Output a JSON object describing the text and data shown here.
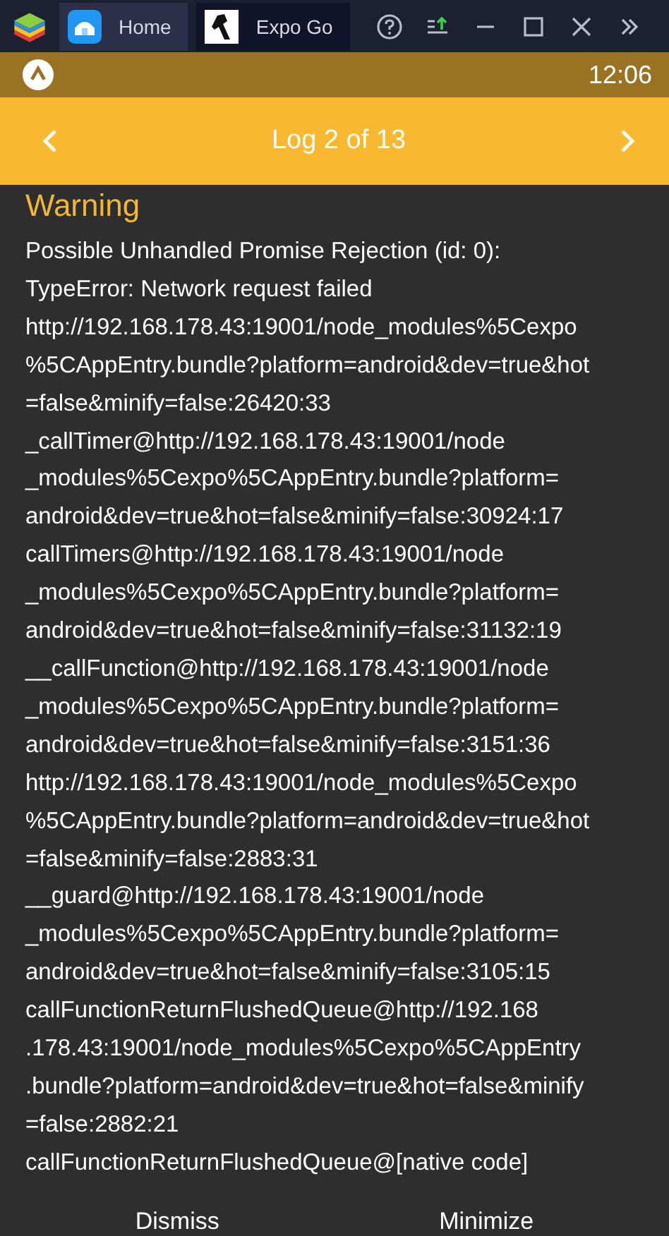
{
  "window": {
    "tabs": [
      {
        "label": "Home",
        "selected": false
      },
      {
        "label": "Expo Go",
        "selected": true
      }
    ]
  },
  "status_bar": {
    "time": "12:06"
  },
  "header": {
    "title": "Log 2 of 13"
  },
  "log": {
    "heading": "Warning",
    "lines": [
      "Possible Unhandled Promise Rejection (id: 0):",
      "TypeError: Network request failed",
      "http://192.168.178.43:19001/node_modules%5Cexpo",
      "%5CAppEntry.bundle?platform=android&dev=true&hot",
      "=false&minify=false:26420:33",
      "_callTimer@http://192.168.178.43:19001/node",
      "_modules%5Cexpo%5CAppEntry.bundle?platform=",
      "android&dev=true&hot=false&minify=false:30924:17",
      "callTimers@http://192.168.178.43:19001/node",
      "_modules%5Cexpo%5CAppEntry.bundle?platform=",
      "android&dev=true&hot=false&minify=false:31132:19",
      "__callFunction@http://192.168.178.43:19001/node",
      "_modules%5Cexpo%5CAppEntry.bundle?platform=",
      "android&dev=true&hot=false&minify=false:3151:36",
      "http://192.168.178.43:19001/node_modules%5Cexpo",
      "%5CAppEntry.bundle?platform=android&dev=true&hot",
      "=false&minify=false:2883:31",
      "__guard@http://192.168.178.43:19001/node",
      "_modules%5Cexpo%5CAppEntry.bundle?platform=",
      "android&dev=true&hot=false&minify=false:3105:15",
      "callFunctionReturnFlushedQueue@http://192.168",
      ".178.43:19001/node_modules%5Cexpo%5CAppEntry",
      ".bundle?platform=android&dev=true&hot=false&minify",
      "=false:2882:21",
      "callFunctionReturnFlushedQueue@[native code]"
    ]
  },
  "buttons": [
    "Dismiss",
    "Minimize"
  ]
}
